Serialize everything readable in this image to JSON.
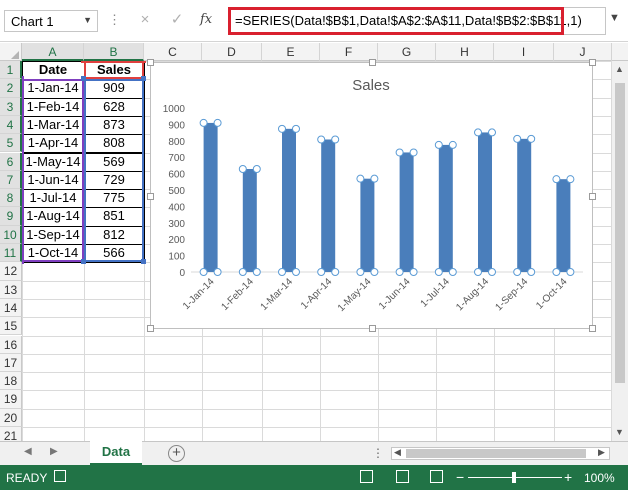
{
  "formula_bar": {
    "name_box": "Chart 1",
    "separator": "⋮",
    "cancel_icon": "×",
    "enter_icon": "✓",
    "fx_label": "fx",
    "formula": "=SERIES(Data!$B$1,Data!$A$2:$A$11,Data!$B$2:$B$11,1)"
  },
  "columns": [
    "A",
    "B",
    "C",
    "D",
    "E",
    "F",
    "G",
    "H",
    "I",
    "J"
  ],
  "rows": [
    "1",
    "2",
    "3",
    "4",
    "5",
    "6",
    "7",
    "8",
    "9",
    "10",
    "11",
    "12",
    "13",
    "14",
    "15",
    "16",
    "17",
    "18",
    "19",
    "20",
    "21"
  ],
  "table": {
    "headers": [
      "Date",
      "Sales"
    ],
    "rows": [
      [
        "1-Jan-14",
        "909"
      ],
      [
        "1-Feb-14",
        "628"
      ],
      [
        "1-Mar-14",
        "873"
      ],
      [
        "1-Apr-14",
        "808"
      ],
      [
        "1-May-14",
        "569"
      ],
      [
        "1-Jun-14",
        "729"
      ],
      [
        "1-Jul-14",
        "775"
      ],
      [
        "1-Aug-14",
        "851"
      ],
      [
        "1-Sep-14",
        "812"
      ],
      [
        "1-Oct-14",
        "566"
      ]
    ]
  },
  "chart_data": {
    "type": "bar",
    "title": "Sales",
    "categories": [
      "1-Jan-14",
      "1-Feb-14",
      "1-Mar-14",
      "1-Apr-14",
      "1-May-14",
      "1-Jun-14",
      "1-Jul-14",
      "1-Aug-14",
      "1-Sep-14",
      "1-Oct-14"
    ],
    "series": [
      {
        "name": "Sales",
        "values": [
          909,
          628,
          873,
          808,
          569,
          729,
          775,
          851,
          812,
          566
        ]
      }
    ],
    "y_ticks": [
      "0",
      "100",
      "200",
      "300",
      "400",
      "500",
      "600",
      "700",
      "800",
      "900",
      "1000"
    ],
    "ylim": [
      0,
      1000
    ],
    "xlabel": "",
    "ylabel": "",
    "grid": false,
    "legend": "none",
    "bar_color": "#4a7ebb"
  },
  "sheet_tabs": {
    "active": "Data",
    "add_icon": "+",
    "nav_prev": "◀",
    "nav_next": "▶"
  },
  "status_bar": {
    "mode": "READY",
    "zoom": "100%",
    "zoom_out": "−",
    "zoom_in": "+"
  },
  "colors": {
    "excel_green": "#217346",
    "formula_highlight": "#d9202f",
    "range_purple": "#7f3fbf",
    "range_blue": "#4472c4",
    "range_red": "#e0403f"
  }
}
